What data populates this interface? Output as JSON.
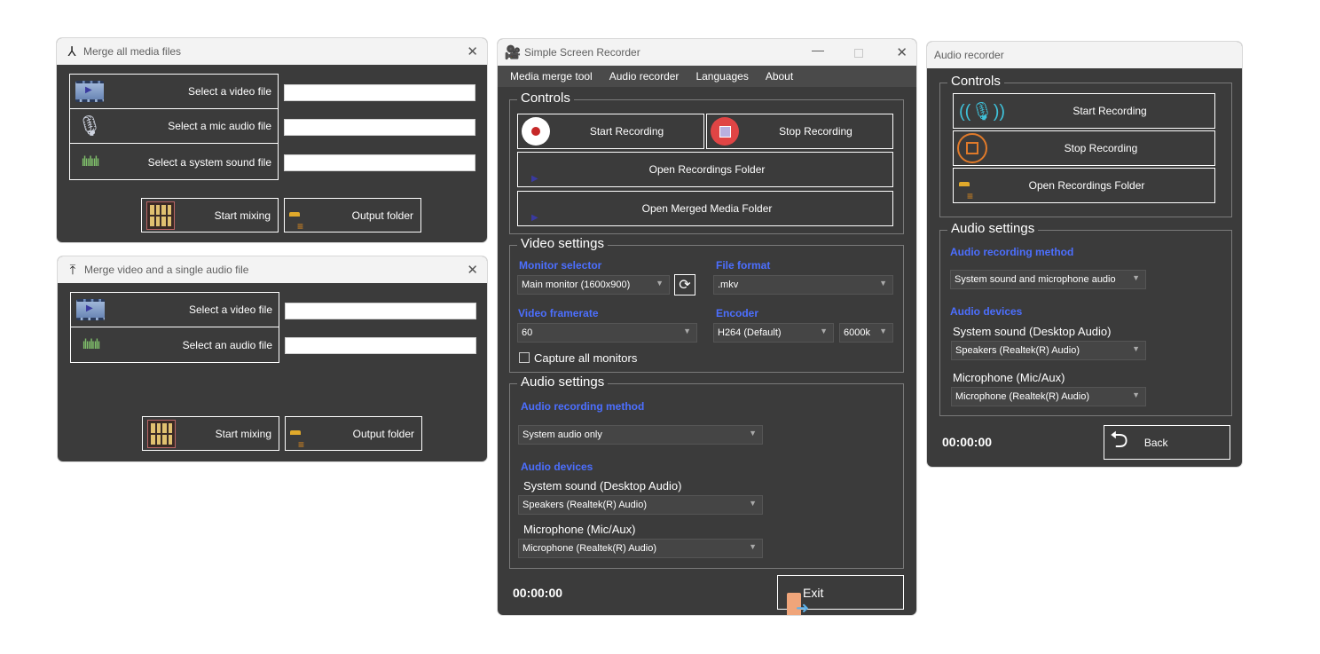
{
  "merge_all": {
    "title": "Merge all media files",
    "rows": [
      {
        "label": "Select a video file",
        "value": ""
      },
      {
        "label": "Select a mic audio file",
        "value": ""
      },
      {
        "label": "Select a system sound file",
        "value": ""
      }
    ],
    "start_mixing": "Start mixing",
    "output_folder": "Output folder"
  },
  "merge_single": {
    "title": "Merge video and a single audio file",
    "rows": [
      {
        "label": "Select a video file",
        "value": ""
      },
      {
        "label": "Select an audio file",
        "value": ""
      }
    ],
    "start_mixing": "Start mixing",
    "output_folder": "Output folder"
  },
  "main": {
    "title": "Simple Screen Recorder",
    "menu": [
      "Media merge tool",
      "Audio recorder",
      "Languages",
      "About"
    ],
    "controls": {
      "legend": "Controls",
      "start": "Start Recording",
      "stop": "Stop Recording",
      "open_recordings": "Open Recordings Folder",
      "open_merged": "Open Merged Media Folder"
    },
    "video": {
      "legend": "Video settings",
      "monitor_label": "Monitor selector",
      "monitor_value": "Main monitor (1600x900)",
      "format_label": "File format",
      "format_value": ".mkv",
      "framerate_label": "Video framerate",
      "framerate_value": "60",
      "encoder_label": "Encoder",
      "encoder_value": "H264 (Default)",
      "bitrate_value": "6000k",
      "capture_all": "Capture all monitors"
    },
    "audio": {
      "legend": "Audio settings",
      "method_label": "Audio recording method",
      "method_value": "System audio only",
      "devices_label": "Audio devices",
      "system_label": "System sound (Desktop Audio)",
      "system_value": "Speakers (Realtek(R) Audio)",
      "mic_label": "Microphone (Mic/Aux)",
      "mic_value": "Microphone (Realtek(R) Audio)"
    },
    "timer": "00:00:00",
    "exit": "Exit"
  },
  "audio_recorder": {
    "title": "Audio recorder",
    "controls": {
      "legend": "Controls",
      "start": "Start Recording",
      "stop": "Stop Recording",
      "open_recordings": "Open Recordings Folder"
    },
    "audio": {
      "legend": "Audio settings",
      "method_label": "Audio recording method",
      "method_value": "System sound and microphone audio",
      "devices_label": "Audio devices",
      "system_label": "System sound (Desktop Audio)",
      "system_value": "Speakers (Realtek(R) Audio)",
      "mic_label": "Microphone (Mic/Aux)",
      "mic_value": "Microphone (Realtek(R) Audio)"
    },
    "timer": "00:00:00",
    "back": "Back"
  }
}
